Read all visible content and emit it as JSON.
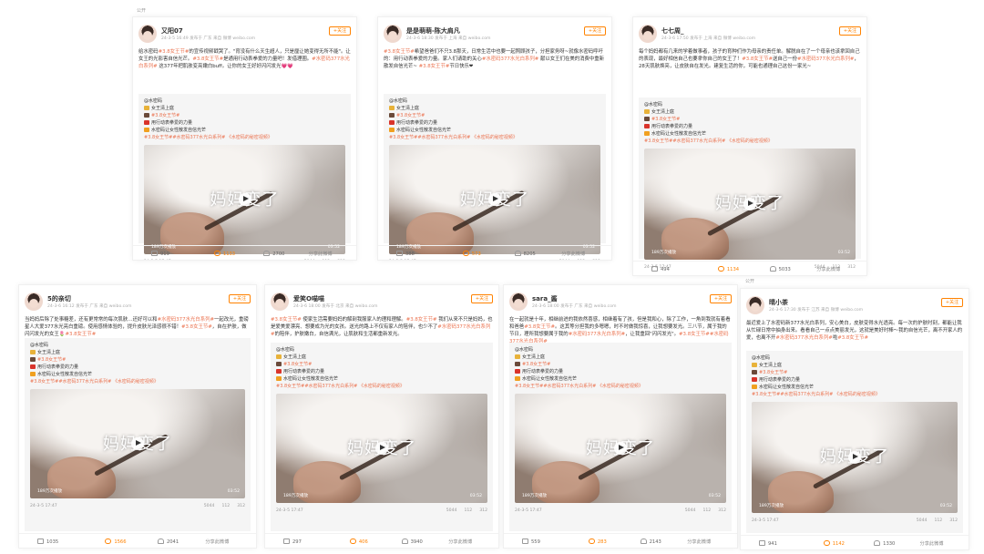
{
  "top_label": "公开",
  "gap_label": "公开",
  "video": {
    "title": "妈妈变了",
    "views": "189万次播放",
    "duration": "03:52"
  },
  "follow_label": "+关注",
  "quoted": {
    "author": "@水密码",
    "line1": "女王清上庭",
    "line2": "#3.8女王节#",
    "line3": "用行动表拳爱的力量",
    "line4": "水密码让女性散发自信光芒",
    "tags": "#3.8女王节##水密码377水光白系列# 《水密码的秘密视频》",
    "date": "24-3-5 17:47",
    "stats": [
      "5044",
      "112",
      "312"
    ]
  },
  "share_more": "分享此微博",
  "posts": [
    {
      "name": "又阳07",
      "meta": "24-3-5 16:49 发布于 广东 来自 微博 weibo.com",
      "text": "给水密码#3.8女王节#的宣传视频戳哭了。\"育没有什么天生超人，只是厘让她变得无所不能\"。让女王的光影害自信光芒。#3.8女王节#是通用行动表拳爱的力量吧！发借理圈。#水密码377水光白系列# 这377年把肌肤变亮嫩白buff。让你的女王好好闪闪发光💗💗",
      "actions": [
        "919",
        "1133",
        "2700"
      ]
    },
    {
      "name": "是是萌萌-陈大肩凡",
      "meta": "24-3-6 18:30 发布于 上海 来自 weibo.com",
      "text": "#3.8女王节#希望爸爸们不只3.8那天，日常生活中也要一起照顾孩子，分担家务呀~就像水密码呼吁的：用行动表拳爱的力量。家人们请助的关心#水密码377水光白系列# 献以女王们在美的消费中重新散发自信光芒~ #3.8女王节#节日快乐❤",
      "actions": [
        "388",
        "573",
        "8205"
      ]
    },
    {
      "name": "七七周_",
      "meta": "24-3-6 17:50 发布于 上海 来自 微博 weibo.com",
      "text": "每个妈妈都有几来的学着做事者，孩子的育种们作为母亲的责任单。解脱自在了一个母亲也该拿回自己的表现，最好相信自己也要拿你自己的女王了！#3.8女王节#送自己一份#水密码377水光白系列#，28天肌肤焕亮，让皮肤自在发光。建复生活的你，可能也通理自己这份一家光~",
      "actions": [
        "494",
        "1134",
        "5033"
      ]
    },
    {
      "name": "5的亲切",
      "meta": "24-3-6 16:12 发布于 广东 来自 weibo.com",
      "text": "当妈妈后除了处事糖差，还有更常常的每次肌肤…还好可以和#水密码377水光白系列#一起改光，重磅星人大爱377水光亮白重磅。使用感情体验的，提升皮肤光泽感很不错！#3.8女王节#，自在护肤，做闪闪发光的女王🌷#3.8女王节#",
      "actions": [
        "1035",
        "1566",
        "2041"
      ]
    },
    {
      "name": "爱笑O喵喵",
      "meta": "24-3-6 18:00 发布于 北京 来自 weibo.com",
      "text": "#3.8女王节# 使家生活需要妈妈的解剖我服家人的理和理解。#3.8女王节# 我们从来不只是妈妈，也是爱美爱漂亮、想要成为光的女孩。送光的路上不仅有家人的陪伴，也少不了#水密码377水光白系列#的陪伴，护肤嫩白，自信满光，让肌肤和生活都重新发光。",
      "actions": [
        "297",
        "406",
        "3940"
      ]
    },
    {
      "name": "sara_酱",
      "meta": "24-3-6 18:00 发布于 广东 来自 weibo.com",
      "text": "在一起就是十年，相继前进的我依然喜感，相继着有了孩，但是我和心，除了工作，一角到我就有着看和爸爸#3.8女王节#。这其等分担我的多嗯嗯，时不时做我惊喜，让我想要发光。三八节，属于我的节日，理所我想要属于我的#水密码377水光白系列#，让我重回\"闪闪发光\"。#3.8女王节##水密码377水光白系列#",
      "actions": [
        "559",
        "283",
        "2143"
      ]
    },
    {
      "name": "晴小茶",
      "meta": "24-3-6 17:30 发布于 江苏 来自 微博 weibo.com",
      "text": "最近爱上了水密码新377水光白系列，安心美白，皮肤变得水光透亮。每一次的护肤时刻，都能让我从忙碌日常中抽身出来。看看自己一点点美丽发光，这就是美好时棒～我的自信光芒，离不开家人的爱，也离不开#水密码377水光白系列#啦#3.8女王节#",
      "actions": [
        "941",
        "1142",
        "1330"
      ]
    }
  ]
}
